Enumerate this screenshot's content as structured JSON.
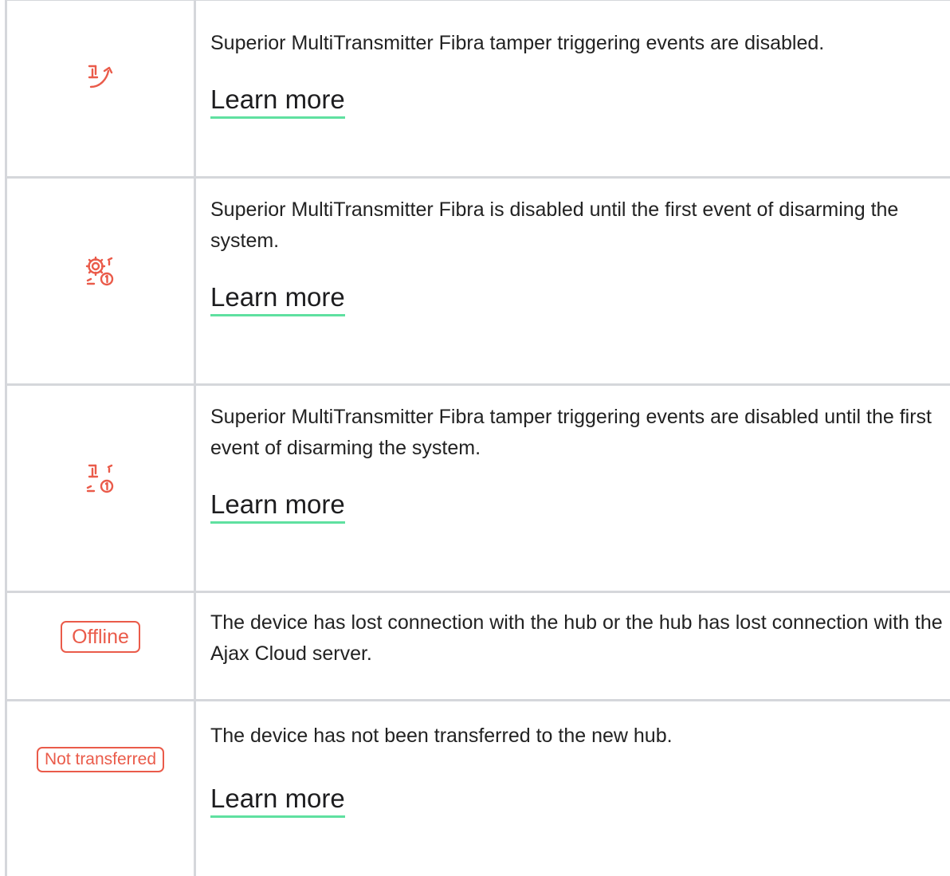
{
  "colors": {
    "accent_red": "#ea5b4a",
    "link_underline": "#5fe0a0",
    "border": "#d5d7db",
    "text": "#222222"
  },
  "rows": [
    {
      "icon": "tamper-disabled-icon",
      "description": "Superior MultiTransmitter Fibra tamper triggering events are disabled.",
      "link": "Learn more"
    },
    {
      "icon": "disabled-until-disarm-icon",
      "description": "Superior MultiTransmitter Fibra is disabled until the first event of disarming the system.",
      "link": "Learn more"
    },
    {
      "icon": "tamper-disabled-until-disarm-icon",
      "description": "Superior MultiTransmitter Fibra tamper triggering events are disabled until the first event of disarming the system.",
      "link": "Learn more"
    },
    {
      "badge": "Offline",
      "description": "The device has lost connection with the hub or the hub has lost connection with the Ajax Cloud server."
    },
    {
      "badge": "Not transferred",
      "description": "The device has not been transferred to the new hub.",
      "link": "Learn more"
    }
  ]
}
